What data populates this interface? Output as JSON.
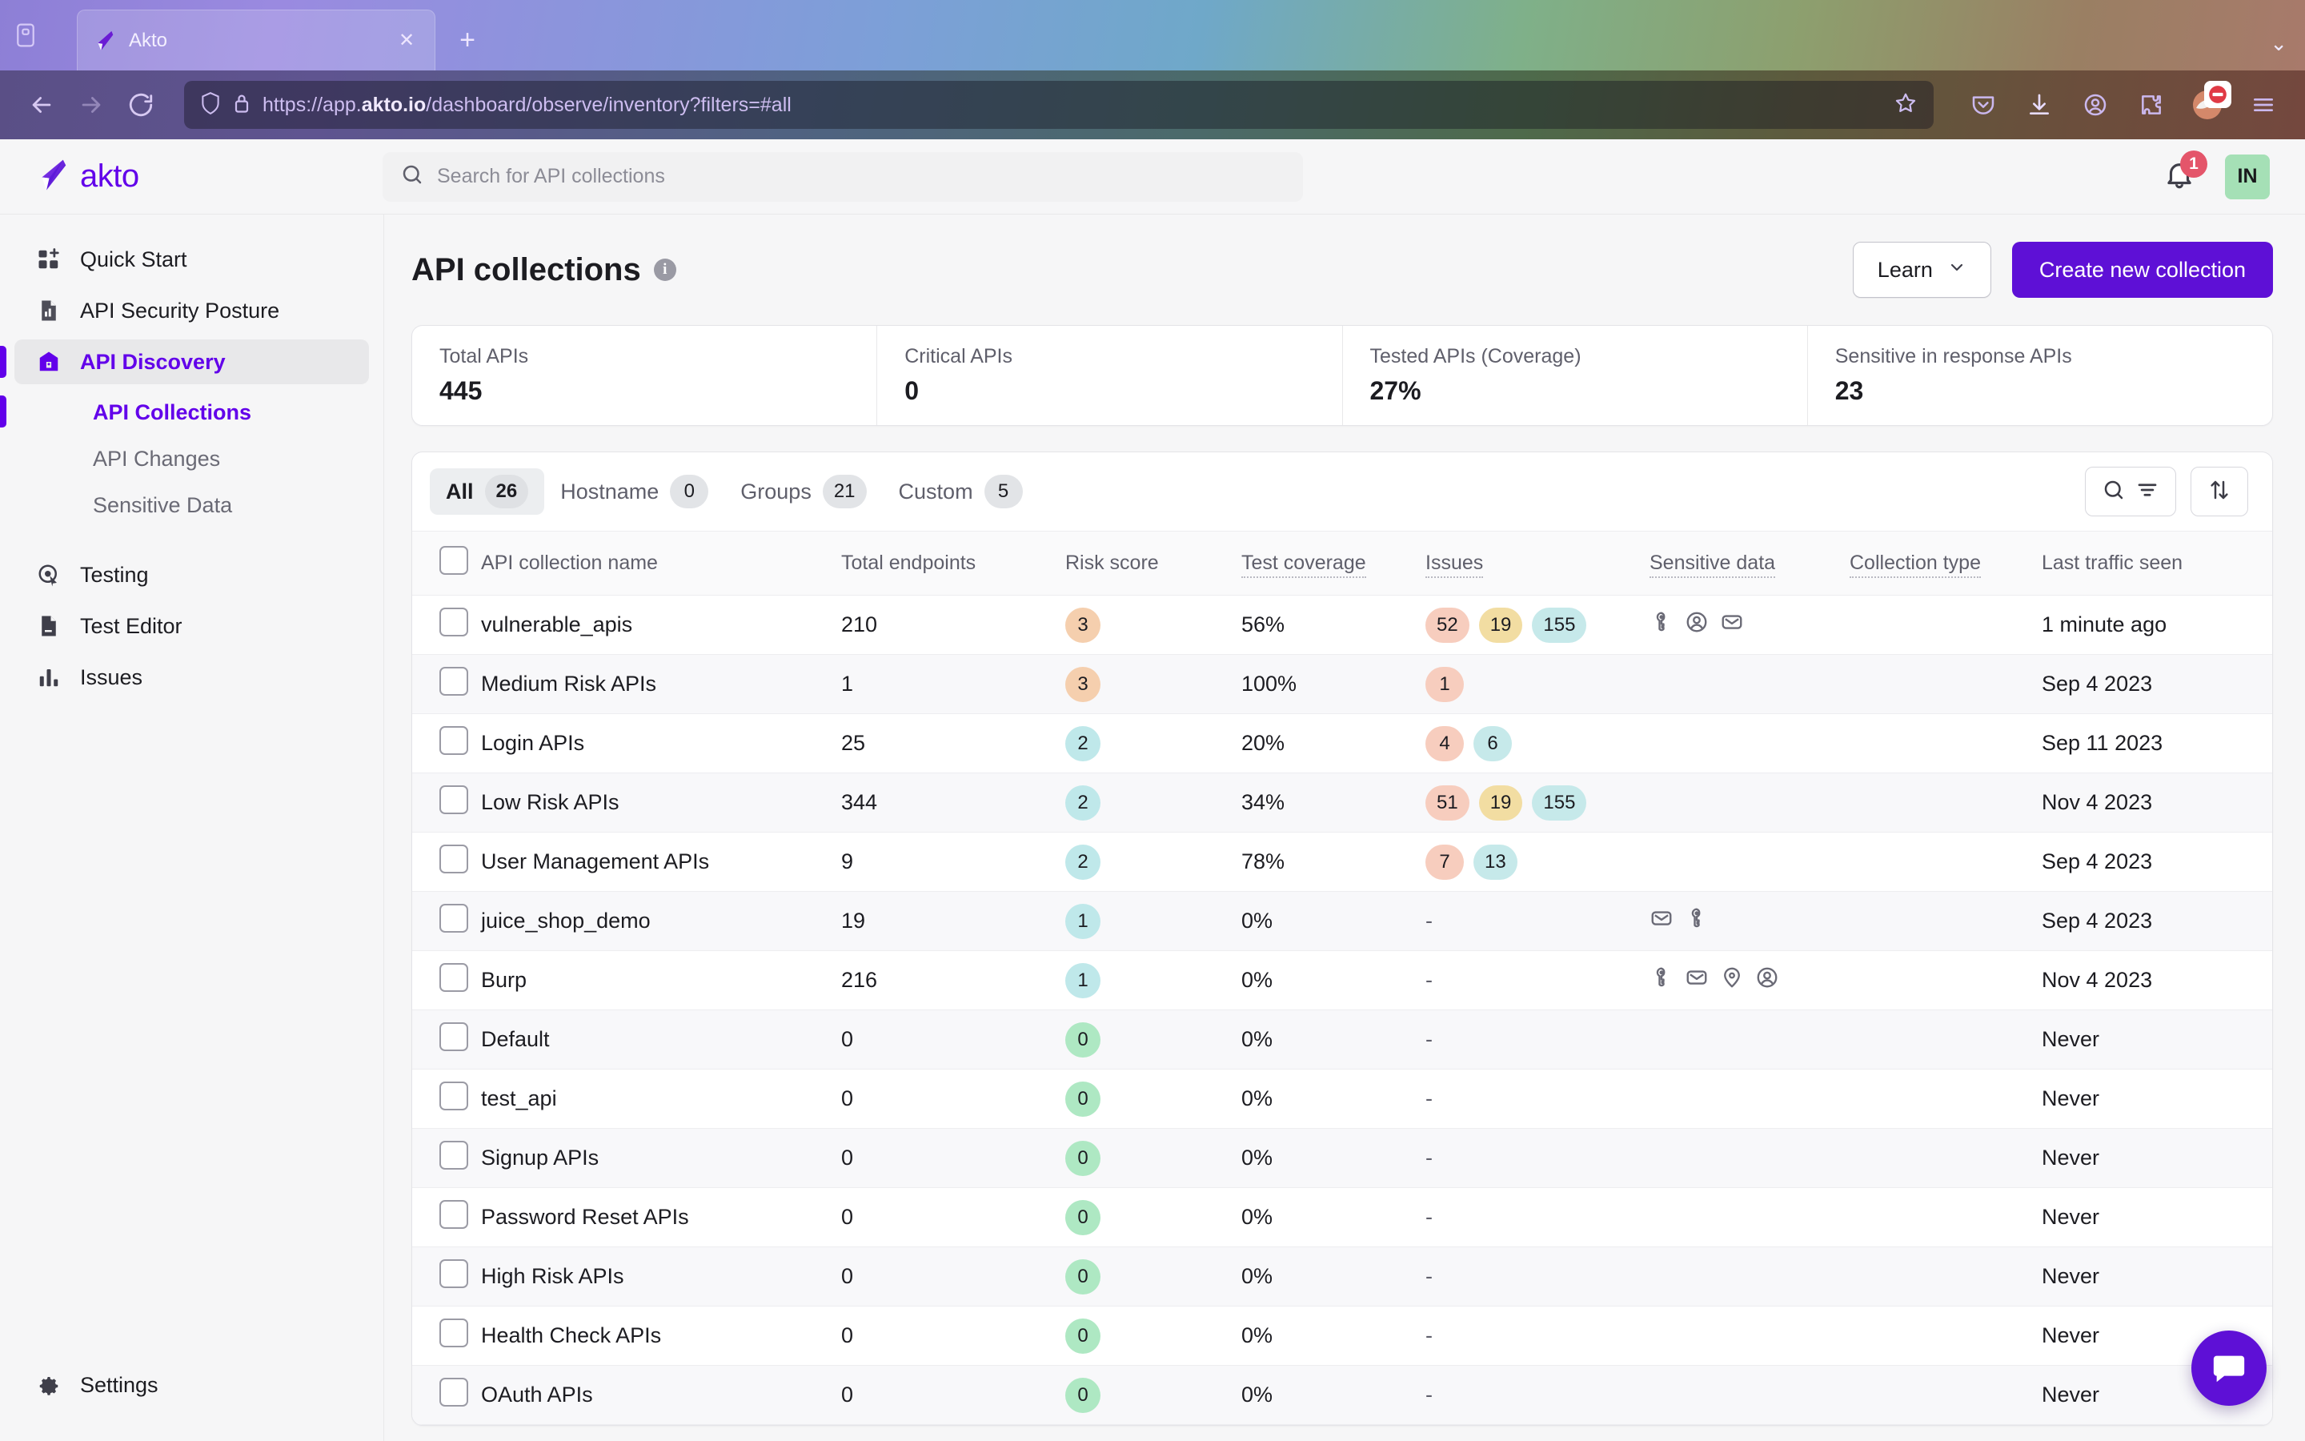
{
  "browser": {
    "tab": {
      "title": "Akto",
      "favicon": "akto-logo-icon",
      "close_label": "✕"
    },
    "newtab_label": "+",
    "list_all_tabs_label": "⌄",
    "back_icon": "back-arrow-icon",
    "forward_icon": "forward-arrow-icon",
    "reload_icon": "reload-icon",
    "url": {
      "scheme": "https://app.",
      "domain": "akto.io",
      "path": "/dashboard/observe/inventory?filters=#all"
    },
    "shield_icon": "shield-icon",
    "lock_icon": "padlock-icon",
    "bookmark_icon": "star-outline-icon",
    "toolbar_icons": [
      "pocket-icon",
      "downloads-icon",
      "account-icon",
      "extensions-icon",
      "firefox-view-icon",
      "app-menu-icon"
    ]
  },
  "header": {
    "brand": "akto",
    "search_placeholder": "Search for API collections",
    "search_value": "",
    "notification_count": "1",
    "avatar_initials": "IN"
  },
  "sidebar": {
    "items": [
      {
        "label": "Quick Start",
        "icon": "grid-plus-icon",
        "active": false
      },
      {
        "label": "API Security Posture",
        "icon": "document-chart-icon",
        "active": false
      },
      {
        "label": "API Discovery",
        "icon": "discovery-icon",
        "active": true
      }
    ],
    "sub_items": [
      {
        "label": "API Collections",
        "active": true
      },
      {
        "label": "API Changes",
        "active": false
      },
      {
        "label": "Sensitive Data",
        "active": false
      }
    ],
    "items2": [
      {
        "label": "Testing",
        "icon": "target-cursor-icon",
        "active": false
      },
      {
        "label": "Test Editor",
        "icon": "document-edit-icon",
        "active": false
      },
      {
        "label": "Issues",
        "icon": "bar-chart-icon",
        "active": false
      }
    ],
    "settings": {
      "label": "Settings",
      "icon": "gear-icon"
    }
  },
  "page": {
    "title": "API collections",
    "info_icon": "info-icon",
    "learn_button": "Learn",
    "learn_chevron": "chevron-down-icon",
    "create_button": "Create new collection"
  },
  "stats": [
    {
      "label": "Total APIs",
      "value": "445"
    },
    {
      "label": "Critical APIs",
      "value": "0"
    },
    {
      "label": "Tested APIs (Coverage)",
      "value": "27%"
    },
    {
      "label": "Sensitive in response APIs",
      "value": "23"
    }
  ],
  "tabs": [
    {
      "label": "All",
      "count": "26",
      "active": true
    },
    {
      "label": "Hostname",
      "count": "0",
      "active": false
    },
    {
      "label": "Groups",
      "count": "21",
      "active": false
    },
    {
      "label": "Custom",
      "count": "5",
      "active": false
    }
  ],
  "table_actions": {
    "search_filter_icon": "search-filter-icon",
    "sort_icon": "sort-arrows-icon"
  },
  "table": {
    "columns": [
      {
        "label": "API collection name",
        "dotted": false
      },
      {
        "label": "Total endpoints",
        "dotted": false
      },
      {
        "label": "Risk score",
        "dotted": false
      },
      {
        "label": "Test coverage",
        "dotted": true
      },
      {
        "label": "Issues",
        "dotted": true
      },
      {
        "label": "Sensitive data",
        "dotted": true
      },
      {
        "label": "Collection type",
        "dotted": true
      },
      {
        "label": "Last traffic seen",
        "dotted": false
      }
    ],
    "rows": [
      {
        "name": "vulnerable_apis",
        "endpoints": "210",
        "risk": "3",
        "risk_color": "orange",
        "coverage": "56%",
        "issues": [
          {
            "value": "52",
            "level": "high"
          },
          {
            "value": "19",
            "level": "med"
          },
          {
            "value": "155",
            "level": "low"
          }
        ],
        "sensitive": [
          "key-icon",
          "person-circle-icon",
          "envelope-icon"
        ],
        "type": "",
        "last_traffic": "1 minute ago"
      },
      {
        "name": "Medium Risk APIs",
        "endpoints": "1",
        "risk": "3",
        "risk_color": "orange",
        "coverage": "100%",
        "issues": [
          {
            "value": "1",
            "level": "high"
          }
        ],
        "sensitive": [],
        "type": "",
        "last_traffic": "Sep 4 2023"
      },
      {
        "name": "Login APIs",
        "endpoints": "25",
        "risk": "2",
        "risk_color": "cyan",
        "coverage": "20%",
        "issues": [
          {
            "value": "4",
            "level": "high"
          },
          {
            "value": "6",
            "level": "low"
          }
        ],
        "sensitive": [],
        "type": "",
        "last_traffic": "Sep 11 2023"
      },
      {
        "name": "Low Risk APIs",
        "endpoints": "344",
        "risk": "2",
        "risk_color": "cyan",
        "coverage": "34%",
        "issues": [
          {
            "value": "51",
            "level": "high"
          },
          {
            "value": "19",
            "level": "med"
          },
          {
            "value": "155",
            "level": "low"
          }
        ],
        "sensitive": [],
        "type": "",
        "last_traffic": "Nov 4 2023"
      },
      {
        "name": "User Management APIs",
        "endpoints": "9",
        "risk": "2",
        "risk_color": "cyan",
        "coverage": "78%",
        "issues": [
          {
            "value": "7",
            "level": "high"
          },
          {
            "value": "13",
            "level": "low"
          }
        ],
        "sensitive": [],
        "type": "",
        "last_traffic": "Sep 4 2023"
      },
      {
        "name": "juice_shop_demo",
        "endpoints": "19",
        "risk": "1",
        "risk_color": "cyan",
        "coverage": "0%",
        "issues": [],
        "issues_dash": "-",
        "sensitive": [
          "envelope-icon",
          "key-icon"
        ],
        "type": "",
        "last_traffic": "Sep 4 2023"
      },
      {
        "name": "Burp",
        "endpoints": "216",
        "risk": "1",
        "risk_color": "cyan",
        "coverage": "0%",
        "issues": [],
        "issues_dash": "-",
        "sensitive": [
          "key-icon",
          "envelope-icon",
          "location-pin-icon",
          "person-circle-icon"
        ],
        "type": "",
        "last_traffic": "Nov 4 2023"
      },
      {
        "name": "Default",
        "endpoints": "0",
        "risk": "0",
        "risk_color": "green",
        "coverage": "0%",
        "issues": [],
        "issues_dash": "-",
        "sensitive": [],
        "type": "",
        "last_traffic": "Never"
      },
      {
        "name": "test_api",
        "endpoints": "0",
        "risk": "0",
        "risk_color": "green",
        "coverage": "0%",
        "issues": [],
        "issues_dash": "-",
        "sensitive": [],
        "type": "",
        "last_traffic": "Never"
      },
      {
        "name": "Signup APIs",
        "endpoints": "0",
        "risk": "0",
        "risk_color": "green",
        "coverage": "0%",
        "issues": [],
        "issues_dash": "-",
        "sensitive": [],
        "type": "",
        "last_traffic": "Never"
      },
      {
        "name": "Password Reset APIs",
        "endpoints": "0",
        "risk": "0",
        "risk_color": "green",
        "coverage": "0%",
        "issues": [],
        "issues_dash": "-",
        "sensitive": [],
        "type": "",
        "last_traffic": "Never"
      },
      {
        "name": "High Risk APIs",
        "endpoints": "0",
        "risk": "0",
        "risk_color": "green",
        "coverage": "0%",
        "issues": [],
        "issues_dash": "-",
        "sensitive": [],
        "type": "",
        "last_traffic": "Never"
      },
      {
        "name": "Health Check APIs",
        "endpoints": "0",
        "risk": "0",
        "risk_color": "green",
        "coverage": "0%",
        "issues": [],
        "issues_dash": "-",
        "sensitive": [],
        "type": "",
        "last_traffic": "Never"
      },
      {
        "name": "OAuth APIs",
        "endpoints": "0",
        "risk": "0",
        "risk_color": "green",
        "coverage": "0%",
        "issues": [],
        "issues_dash": "-",
        "sensitive": [],
        "type": "",
        "last_traffic": "Never"
      }
    ]
  },
  "chat": {
    "icon": "chat-bubble-icon"
  },
  "colors": {
    "brand_purple": "#6200ea",
    "primary_button": "#5e10d6",
    "risk_orange": "#f5cfae",
    "risk_cyan": "#bfe8ea",
    "risk_green": "#aee8c3",
    "issue_high": "#f7cdbe",
    "issue_medium": "#f2dda2",
    "issue_low": "#c6e9ea",
    "avatar_green": "#a5e0b6",
    "notification_red": "#e4556a"
  }
}
